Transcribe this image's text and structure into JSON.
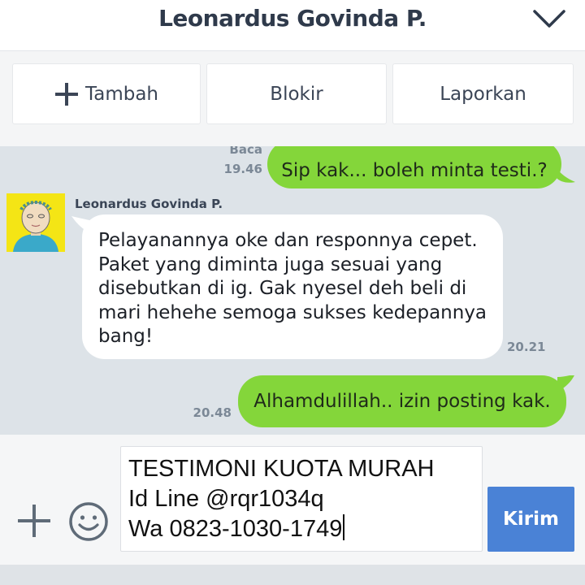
{
  "header": {
    "title": "Leonardus Govinda P.",
    "collapse_icon": "chevron-down-icon"
  },
  "actions": {
    "add_label": "Tambah",
    "block_label": "Blokir",
    "report_label": "Laporkan"
  },
  "chat": {
    "messages": [
      {
        "direction": "outgoing",
        "read_label": "Baca",
        "time": "19.46",
        "text": "Sip kak... boleh minta testi.?"
      },
      {
        "direction": "incoming",
        "sender": "Leonardus Govinda P.",
        "time": "20.21",
        "text": "Pelayanannya oke dan responnya cepet.\nPaket yang diminta juga sesuai yang\ndisebutkan di ig. Gak nyesel deh beli di\nmari hehehe semoga sukses kedepannya\nbang!"
      },
      {
        "direction": "outgoing",
        "time": "20.48",
        "text": "Alhamdulillah.. izin posting kak."
      }
    ]
  },
  "composer": {
    "text": "TESTIMONI KUOTA MURAH\nId Line @rqr1034q\nWa 0823-1030-1749",
    "send_label": "Kirim",
    "plus_icon": "plus-icon",
    "emoji_icon": "smiley-icon"
  },
  "colors": {
    "outgoing_bubble": "#84d63a",
    "incoming_bubble": "#ffffff",
    "chat_background": "#dde3e8",
    "send_button": "#4a82d6"
  }
}
